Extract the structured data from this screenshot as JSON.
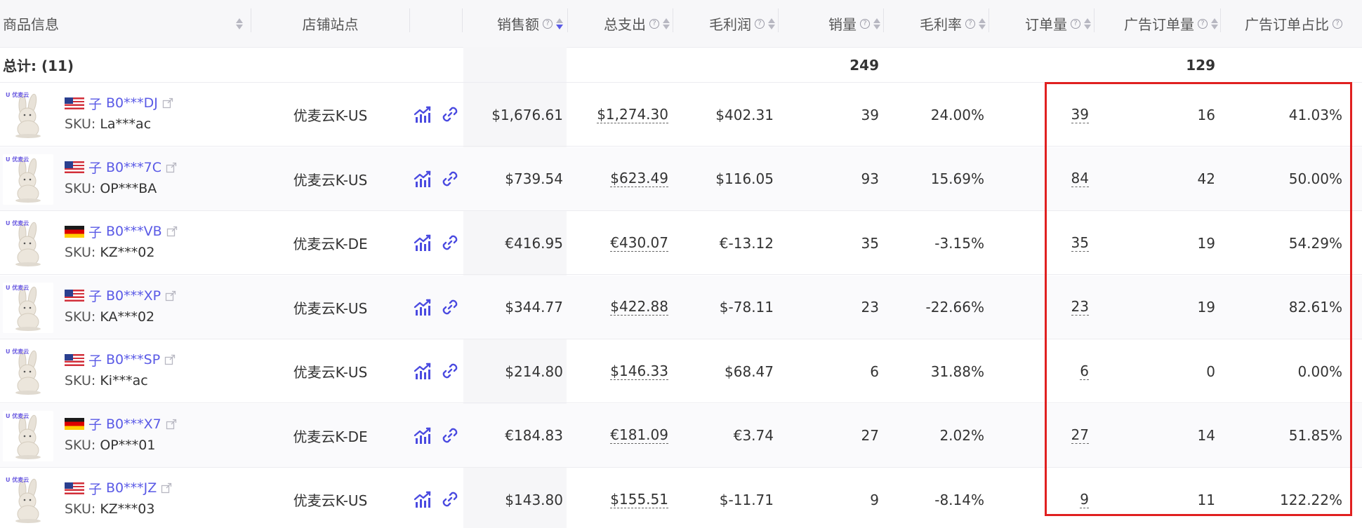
{
  "columns": {
    "product_info": "商品信息",
    "store_site": "店铺站点",
    "sales": "销售额",
    "total_expense": "总支出",
    "gross_profit": "毛利润",
    "units_sold": "销量",
    "gross_margin": "毛利率",
    "orders": "订单量",
    "ad_orders": "广告订单量",
    "ad_order_ratio": "广告订单占比"
  },
  "total": {
    "label": "总计: (11)",
    "units_sold": "249",
    "ad_orders": "129"
  },
  "product_child_label": "子",
  "sku_label": "SKU:",
  "thumb_brand": "U 优麦云",
  "rows": [
    {
      "flag": "us",
      "asin": "B0***DJ",
      "sku": "La***ac",
      "store": "优麦云K-US",
      "sales": "$1,676.61",
      "expense": "$1,274.30",
      "profit": "$402.31",
      "units": "39",
      "margin": "24.00%",
      "orders": "39",
      "ad_orders": "16",
      "ad_ratio": "41.03%"
    },
    {
      "flag": "us",
      "asin": "B0***7C",
      "sku": "OP***BA",
      "store": "优麦云K-US",
      "sales": "$739.54",
      "expense": "$623.49",
      "profit": "$116.05",
      "units": "93",
      "margin": "15.69%",
      "orders": "84",
      "ad_orders": "42",
      "ad_ratio": "50.00%"
    },
    {
      "flag": "de",
      "asin": "B0***VB",
      "sku": "KZ***02",
      "store": "优麦云K-DE",
      "sales": "€416.95",
      "expense": "€430.07",
      "profit": "€-13.12",
      "units": "35",
      "margin": "-3.15%",
      "orders": "35",
      "ad_orders": "19",
      "ad_ratio": "54.29%"
    },
    {
      "flag": "us",
      "asin": "B0***XP",
      "sku": "KA***02",
      "store": "优麦云K-US",
      "sales": "$344.77",
      "expense": "$422.88",
      "profit": "$-78.11",
      "units": "23",
      "margin": "-22.66%",
      "orders": "23",
      "ad_orders": "19",
      "ad_ratio": "82.61%"
    },
    {
      "flag": "us",
      "asin": "B0***SP",
      "sku": "Ki***ac",
      "store": "优麦云K-US",
      "sales": "$214.80",
      "expense": "$146.33",
      "profit": "$68.47",
      "units": "6",
      "margin": "31.88%",
      "orders": "6",
      "ad_orders": "0",
      "ad_ratio": "0.00%"
    },
    {
      "flag": "de",
      "asin": "B0***X7",
      "sku": "OP***01",
      "store": "优麦云K-DE",
      "sales": "€184.83",
      "expense": "€181.09",
      "profit": "€3.74",
      "units": "27",
      "margin": "2.02%",
      "orders": "27",
      "ad_orders": "14",
      "ad_ratio": "51.85%"
    },
    {
      "flag": "us",
      "asin": "B0***JZ",
      "sku": "KZ***03",
      "store": "优麦云K-US",
      "sales": "$143.80",
      "expense": "$155.51",
      "profit": "$-11.71",
      "units": "9",
      "margin": "-8.14%",
      "orders": "9",
      "ad_orders": "11",
      "ad_ratio": "122.22%"
    }
  ],
  "colors": {
    "accent": "#5a5ae6",
    "highlight": "#e02020",
    "header_bg": "#f7f7f9"
  },
  "icons": {
    "help": "question-circle-icon",
    "sort": "sort-icon",
    "trend": "trend-chart-icon",
    "link": "link-icon",
    "external": "external-link-icon"
  }
}
